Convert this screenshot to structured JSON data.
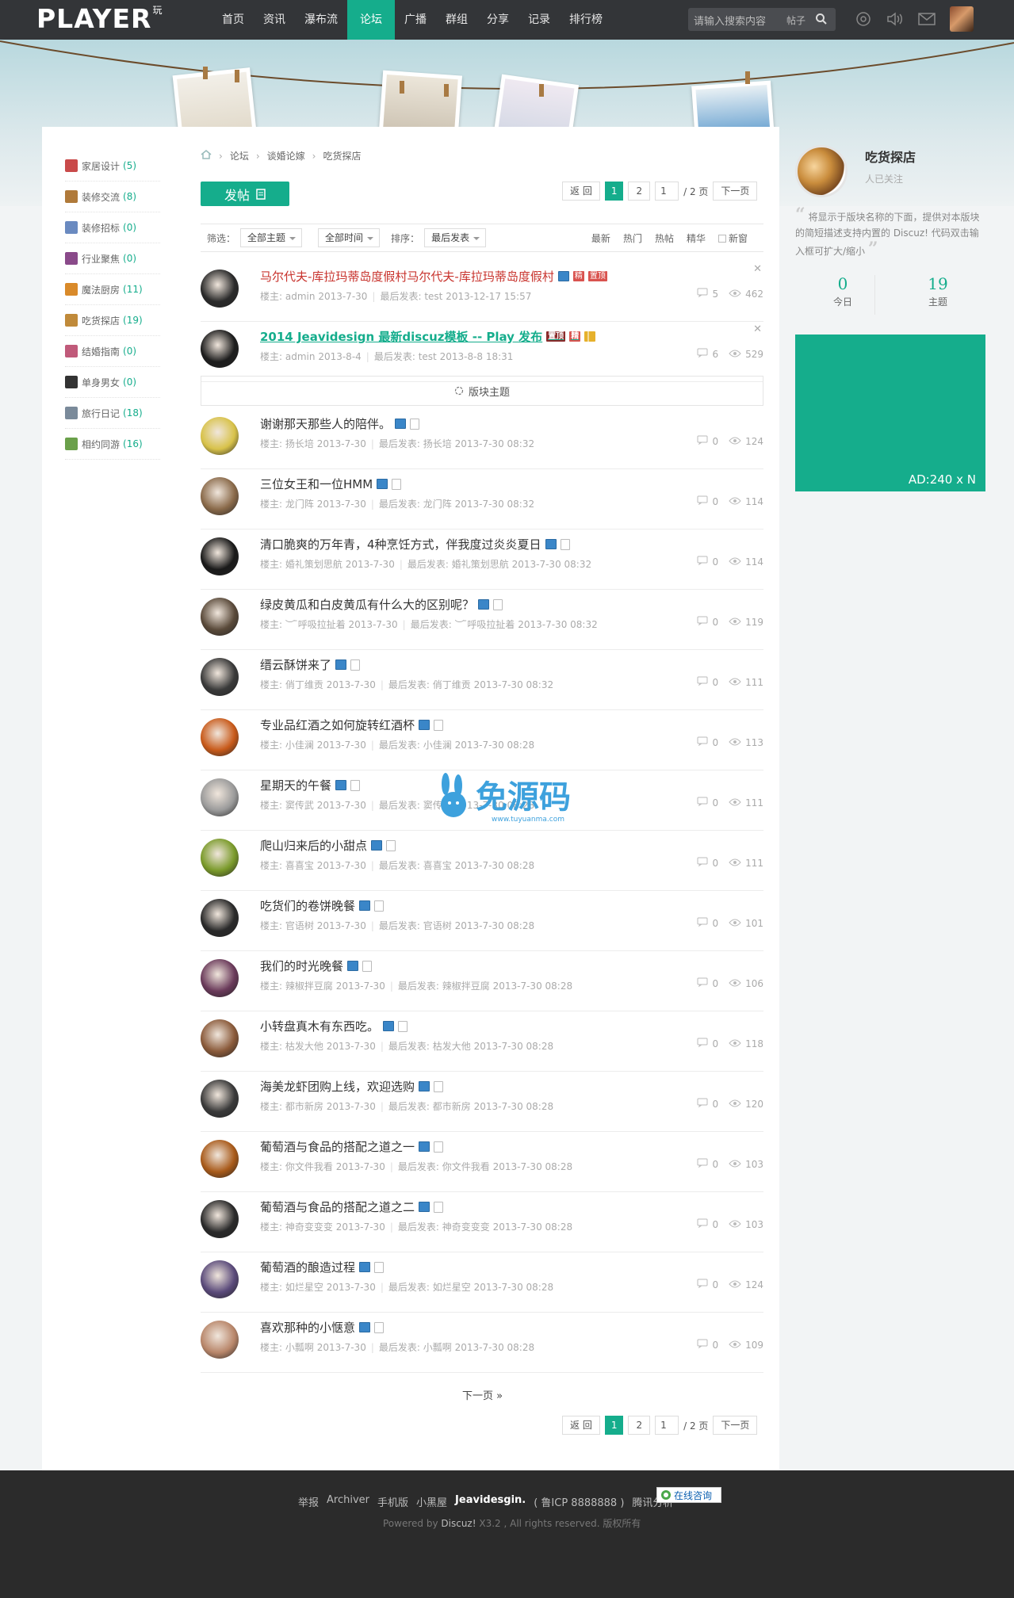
{
  "header": {
    "logo": "PLAYER",
    "logo_sup": "玩",
    "nav": [
      "首页",
      "资讯",
      "瀑布流",
      "论坛",
      "广播",
      "群组",
      "分享",
      "记录",
      "排行榜"
    ],
    "active_nav": "论坛",
    "search": {
      "placeholder": "请输入搜索内容",
      "type": "帖子"
    }
  },
  "sidebar": {
    "forums": [
      {
        "name": "家居设计",
        "count": "(5)",
        "color": "#c94a4a"
      },
      {
        "name": "装修交流",
        "count": "(8)",
        "color": "#b07a3a"
      },
      {
        "name": "装修招标",
        "count": "(0)",
        "color": "#6a8ac0"
      },
      {
        "name": "行业聚焦",
        "count": "(0)",
        "color": "#8a4a8a"
      },
      {
        "name": "魔法厨房",
        "count": "(11)",
        "color": "#d98a2a"
      },
      {
        "name": "吃货探店",
        "count": "(19)",
        "color": "#c08a3a"
      },
      {
        "name": "结婚指南",
        "count": "(0)",
        "color": "#c05a7a"
      },
      {
        "name": "单身男女",
        "count": "(0)",
        "color": "#333333"
      },
      {
        "name": "旅行日记",
        "count": "(18)",
        "color": "#7a8a9a"
      },
      {
        "name": "相约同游",
        "count": "(16)",
        "color": "#6aa04a"
      }
    ]
  },
  "breadcrumb": [
    "论坛",
    "谈婚论嫁",
    "吃货探店"
  ],
  "post_button": "发帖",
  "pager": {
    "back": "返 回",
    "p1": "1",
    "p2": "2",
    "input": "1",
    "total": "/ 2 页",
    "next": "下一页"
  },
  "filter": {
    "label_filter": "筛选：",
    "all_topics": "全部主题",
    "all_time": "全部时间",
    "label_sort": "排序：",
    "last_post": "最后发表",
    "tabs": [
      "最新",
      "热门",
      "热帖",
      "精华"
    ],
    "new_window": "新窗"
  },
  "labels": {
    "author": "楼主:",
    "last": "最后发表:"
  },
  "section_label": "版块主题",
  "next_page_link": "下一页 »",
  "sticky": [
    {
      "title": "马尔代夫-库拉玛蒂岛度假村马尔代夫-库拉玛蒂岛度假村",
      "style": "red",
      "tags": [
        "img",
        "精",
        "置顶"
      ],
      "author": "admin",
      "date": "2013-7-30",
      "last_user": "test",
      "last_date": "2013-12-17 15:57",
      "replies": "5",
      "views": "462",
      "avatar": "#2a2a2a"
    },
    {
      "title": "2014 Jeavidesign 最新discuz模板 -- Play 发布",
      "style": "link",
      "tags": [
        "置顶",
        "精",
        "bar"
      ],
      "author": "admin",
      "date": "2013-8-4",
      "last_user": "test",
      "last_date": "2013-8-8 18:31",
      "replies": "6",
      "views": "529",
      "avatar": "#1d1d1d"
    }
  ],
  "threads": [
    {
      "title": "谢谢那天那些人的陪伴。",
      "author": "扬长培",
      "date": "2013-7-30",
      "last_user": "扬长培",
      "last_date": "2013-7-30 08:32",
      "replies": "0",
      "views": "124",
      "avatar": "#d8c24a"
    },
    {
      "title": "三位女王和一位HMM",
      "author": "龙门阵",
      "date": "2013-7-30",
      "last_user": "龙门阵",
      "last_date": "2013-7-30 08:32",
      "replies": "0",
      "views": "114",
      "avatar": "#8a6a4a"
    },
    {
      "title": "清口脆爽的万年青，4种烹饪方式，伴我度过炎炎夏日",
      "author": "婚礼策划思航",
      "date": "2013-7-30",
      "last_user": "婚礼策划思航",
      "last_date": "2013-7-30 08:32",
      "replies": "0",
      "views": "114",
      "avatar": "#1a1a1a"
    },
    {
      "title": "绿皮黄瓜和白皮黄瓜有什么大的区别呢？",
      "author": "︶ ̄呼吸拉扯着",
      "date": "2013-7-30",
      "last_user": "︶ ̄呼吸拉扯着",
      "last_date": "2013-7-30 08:32",
      "replies": "0",
      "views": "119",
      "avatar": "#5a4a3a"
    },
    {
      "title": "缙云酥饼来了",
      "author": "俏丁维贡",
      "date": "2013-7-30",
      "last_user": "俏丁维贡",
      "last_date": "2013-7-30 08:32",
      "replies": "0",
      "views": "111",
      "avatar": "#3a3a3a"
    },
    {
      "title": "专业品红酒之如何旋转红酒杯",
      "author": "小佳澜",
      "date": "2013-7-30",
      "last_user": "小佳澜",
      "last_date": "2013-7-30 08:28",
      "replies": "0",
      "views": "113",
      "avatar": "#c85a1a"
    },
    {
      "title": "星期天的午餐",
      "author": "窦传武",
      "date": "2013-7-30",
      "last_user": "窦传武",
      "last_date": "2013-7-30 08:28",
      "replies": "0",
      "views": "111",
      "avatar": "#9a9a9a"
    },
    {
      "title": "爬山归来后的小甜点",
      "author": "喜喜宝",
      "date": "2013-7-30",
      "last_user": "喜喜宝",
      "last_date": "2013-7-30 08:28",
      "replies": "0",
      "views": "111",
      "avatar": "#7a9a2a"
    },
    {
      "title": "吃货们的卷饼晚餐",
      "author": "官语树",
      "date": "2013-7-30",
      "last_user": "官语树",
      "last_date": "2013-7-30 08:28",
      "replies": "0",
      "views": "101",
      "avatar": "#2a2a2a"
    },
    {
      "title": "我们的时光晚餐",
      "author": "辣椒拌豆腐",
      "date": "2013-7-30",
      "last_user": "辣椒拌豆腐",
      "last_date": "2013-7-30 08:28",
      "replies": "0",
      "views": "106",
      "avatar": "#6a3a5a"
    },
    {
      "title": "小转盘真木有东西吃。",
      "author": "枯发大他",
      "date": "2013-7-30",
      "last_user": "枯发大他",
      "last_date": "2013-7-30 08:28",
      "replies": "0",
      "views": "118",
      "avatar": "#8a5a3a"
    },
    {
      "title": "海美龙虾团购上线，欢迎选购",
      "author": "都市新房",
      "date": "2013-7-30",
      "last_user": "都市新房",
      "last_date": "2013-7-30 08:28",
      "replies": "0",
      "views": "120",
      "avatar": "#3a3a3a"
    },
    {
      "title": "葡萄酒与食品的搭配之道之一",
      "author": "你文件我看",
      "date": "2013-7-30",
      "last_user": "你文件我看",
      "last_date": "2013-7-30 08:28",
      "replies": "0",
      "views": "103",
      "avatar": "#a85a1a"
    },
    {
      "title": "葡萄酒与食品的搭配之道之二",
      "author": "神奇变变变",
      "date": "2013-7-30",
      "last_user": "神奇变变变",
      "last_date": "2013-7-30 08:28",
      "replies": "0",
      "views": "103",
      "avatar": "#2a2a2a"
    },
    {
      "title": "葡萄酒的酿造过程",
      "author": "如烂星空",
      "date": "2013-7-30",
      "last_user": "如烂星空",
      "last_date": "2013-7-30 08:28",
      "replies": "0",
      "views": "124",
      "avatar": "#5a4a7a"
    },
    {
      "title": "喜欢那种的小惬意",
      "author": "小瓢啊",
      "date": "2013-7-30",
      "last_user": "小瓢啊",
      "last_date": "2013-7-30 08:28",
      "replies": "0",
      "views": "109",
      "avatar": "#b8866a"
    }
  ],
  "right": {
    "name": "吃货探店",
    "followers": "人已关注",
    "desc": "将显示于版块名称的下面，提供对本版块的简短描述支持内置的 Discuz! 代码双击输入框可扩大/缩小",
    "today_num": "0",
    "today_label": "今日",
    "topics_num": "19",
    "topics_label": "主题",
    "ad": "AD:240 x N"
  },
  "footer": {
    "links": [
      "举报",
      "Archiver",
      "手机版",
      "小黑屋"
    ],
    "brand": "Jeavidesgin.",
    "icp": "( 鲁ICP 8888888 )",
    "stat": "腾讯分析",
    "chat": "在线咨询",
    "powered": "Powered by",
    "discuz": "Discuz!",
    "version": "X3.2 , All rights reserved. 版权所有"
  },
  "watermark": {
    "main": "免源码",
    "url": "www.tuyuanma.com"
  },
  "colors": {
    "accent": "#15ad8c",
    "topbar": "#333538",
    "footer": "#2b2b2b",
    "sticky_red": "#c8332d"
  }
}
